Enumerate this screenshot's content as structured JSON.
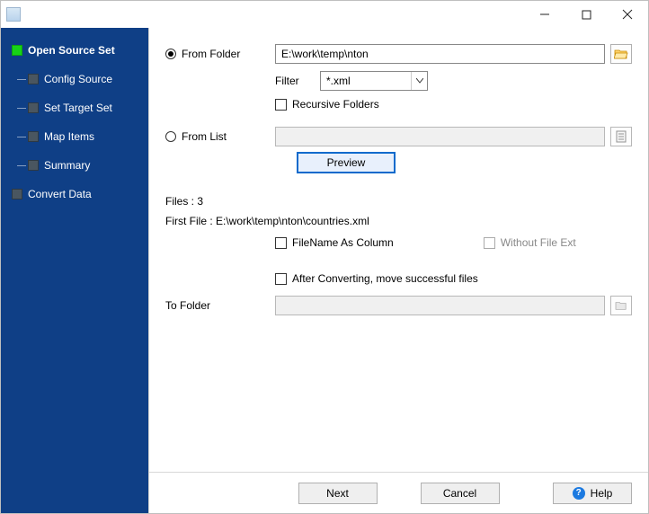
{
  "sidebar": {
    "items": [
      {
        "label": "Open Source Set",
        "active": true
      },
      {
        "label": "Config Source"
      },
      {
        "label": "Set Target Set"
      },
      {
        "label": "Map Items"
      },
      {
        "label": "Summary"
      },
      {
        "label": "Convert Data"
      }
    ]
  },
  "source": {
    "from_folder_label": "From Folder",
    "from_folder_path": "E:\\work\\temp\\nton",
    "filter_label": "Filter",
    "filter_value": "*.xml",
    "recursive_label": "Recursive Folders",
    "from_list_label": "From List",
    "from_list_value": "",
    "preview_label": "Preview"
  },
  "files": {
    "count_label": "Files : 3",
    "first_file_label": "First File : E:\\work\\temp\\nton\\countries.xml",
    "filename_as_column_label": "FileName As Column",
    "without_ext_label": "Without File Ext"
  },
  "move": {
    "after_label": "After Converting, move successful files",
    "to_folder_label": "To Folder",
    "to_folder_value": ""
  },
  "footer": {
    "next": "Next",
    "cancel": "Cancel",
    "help": "Help"
  }
}
